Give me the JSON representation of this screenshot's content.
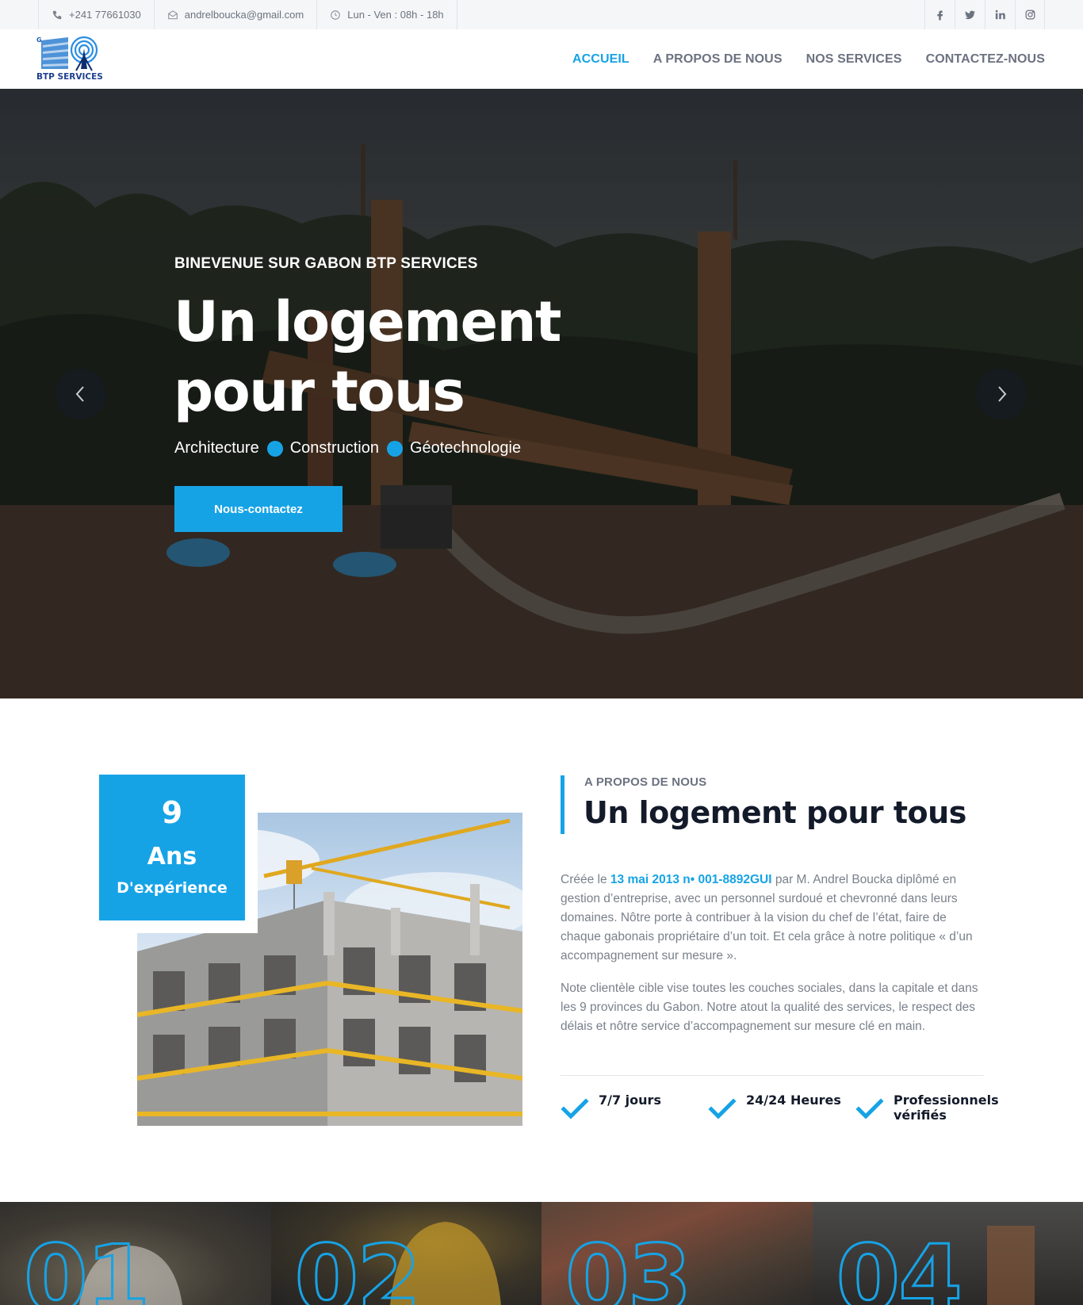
{
  "topbar": {
    "phone": "+241 77661030",
    "email": "andrelboucka@gmail.com",
    "hours": "Lun - Ven : 08h - 18h",
    "social": [
      {
        "icon": "facebook-icon",
        "glyph": "f"
      },
      {
        "icon": "twitter-icon",
        "glyph": ""
      },
      {
        "icon": "linkedin-icon",
        "glyph": "in"
      },
      {
        "icon": "instagram-icon",
        "glyph": ""
      }
    ]
  },
  "logo": {
    "text_top": "GABON",
    "text_bottom": "BTP SERVICES"
  },
  "nav": {
    "items": [
      {
        "label": "ACCUEIL",
        "active": true
      },
      {
        "label": "A PROPOS DE NOUS"
      },
      {
        "label": "NOS SERVICES"
      },
      {
        "label": "CONTACTEZ-NOUS"
      }
    ]
  },
  "hero": {
    "eyebrow": "BINEVENUE SUR GABON BTP SERVICES",
    "title_line1": "Un logement",
    "title_line2": "pour tous",
    "tags": [
      "Architecture",
      "Construction",
      "Géotechnologie"
    ],
    "cta": "Nous-contactez",
    "prev_icon": "chevron-left-icon",
    "next_icon": "chevron-right-icon"
  },
  "experience": {
    "number": "9",
    "unit": "Ans",
    "label": "D'expérience"
  },
  "about": {
    "eyebrow": "A PROPOS DE NOUS",
    "title": "Un logement pour tous",
    "p1_before": "Créée le ",
    "p1_highlight": "13 mai 2013 n• 001-8892GUI",
    "p1_after": " par M. Andrel Boucka diplômé en gestion d’entreprise, avec un personnel surdoué et chevronné dans leurs domaines. Nôtre porte à contribuer à la vision du chef de l’état, faire de chaque gabonais propriétaire d’un toit. Et cela grâce à notre politique « d’un accompagnement sur mesure ».",
    "p2": "Note clientèle cible vise toutes les couches sociales, dans la capitale et dans les 9 provinces du Gabon. Notre atout la qualité des services, le respect des délais et nôtre service d’accompagnement sur mesure clé en main.",
    "features": [
      "7/7 jours",
      "24/24 Heures",
      "Professionnels vérifiés"
    ]
  },
  "services": {
    "numbers": [
      "01",
      "02",
      "03",
      "04"
    ]
  },
  "colors": {
    "accent": "#16a3e6",
    "dark": "#131a2a",
    "muted": "#7a808b"
  }
}
